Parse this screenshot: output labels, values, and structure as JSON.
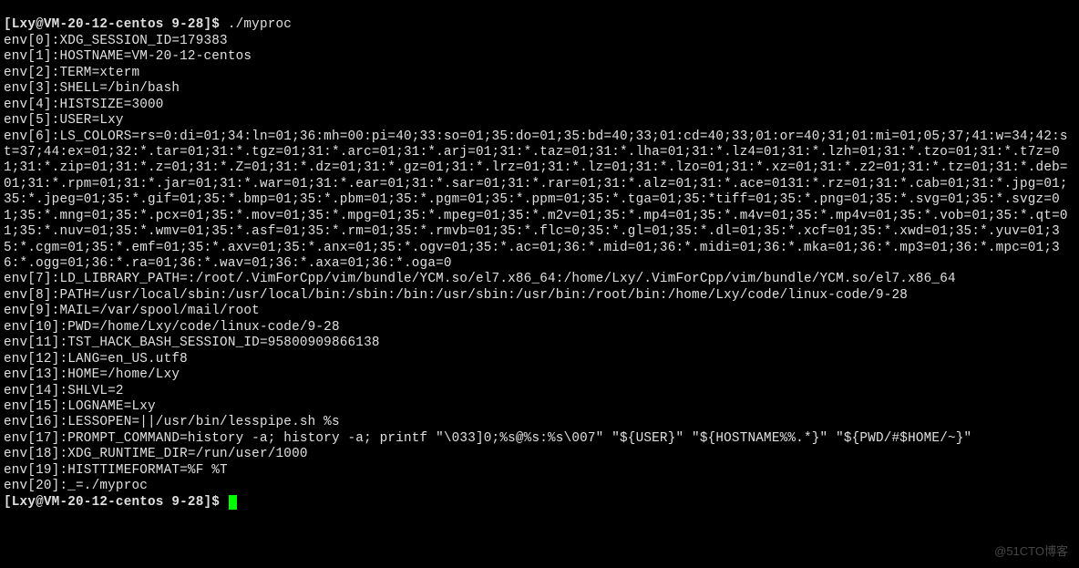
{
  "prompt1": {
    "user_host_path": "[Lxy@VM-20-12-centos 9-28]$",
    "command": "./myproc"
  },
  "env_lines": [
    "env[0]:XDG_SESSION_ID=179383",
    "env[1]:HOSTNAME=VM-20-12-centos",
    "env[2]:TERM=xterm",
    "env[3]:SHELL=/bin/bash",
    "env[4]:HISTSIZE=3000",
    "env[5]:USER=Lxy",
    "env[6]:LS_COLORS=rs=0:di=01;34:ln=01;36:mh=00:pi=40;33:so=01;35:do=01;35:bd=40;33;01:cd=40;33;01:or=40;31;01:mi=01;05;37;41:w=34;42:st=37;44:ex=01;32:*.tar=01;31:*.tgz=01;31:*.arc=01;31:*.arj=01;31:*.taz=01;31:*.lha=01;31:*.lz4=01;31:*.lzh=01;31:*.tzo=01;31:*.t7z=01;31:*.zip=01;31:*.z=01;31:*.Z=01;31:*.dz=01;31:*.gz=01;31:*.lrz=01;31:*.lz=01;31:*.lzo=01;31:*.xz=01;31:*.z2=01;31:*.tz=01;31:*.deb=01;31:*.rpm=01;31:*.jar=01;31:*.war=01;31:*.ear=01;31:*.sar=01;31:*.rar=01;31:*.alz=01;31:*.ace=0131:*.rz=01;31:*.cab=01;31:*.jpg=01;35:*.jpeg=01;35:*.gif=01;35:*.bmp=01;35:*.pbm=01;35:*.pgm=01;35:*.ppm=01;35:*.tga=01;35:*tiff=01;35:*.png=01;35:*.svg=01;35:*.svgz=01;35:*.mng=01;35:*.pcx=01;35:*.mov=01;35:*.mpg=01;35:*.mpeg=01;35:*.m2v=01;35:*.mp4=01;35:*.m4v=01;35:*.mp4v=01;35:*.vob=01;35:*.qt=01;35:*.nuv=01;35:*.wmv=01;35:*.asf=01;35:*.rm=01;35:*.rmvb=01;35:*.flc=0;35:*.gl=01;35:*.dl=01;35:*.xcf=01;35:*.xwd=01;35:*.yuv=01;35:*.cgm=01;35:*.emf=01;35:*.axv=01;35:*.anx=01;35:*.ogv=01;35:*.ac=01;36:*.mid=01;36:*.midi=01;36:*.mka=01;36:*.mp3=01;36:*.mpc=01;36:*.ogg=01;36:*.ra=01;36:*.wav=01;36:*.axa=01;36:*.oga=0",
    "env[7]:LD_LIBRARY_PATH=:/root/.VimForCpp/vim/bundle/YCM.so/el7.x86_64:/home/Lxy/.VimForCpp/vim/bundle/YCM.so/el7.x86_64",
    "env[8]:PATH=/usr/local/sbin:/usr/local/bin:/sbin:/bin:/usr/sbin:/usr/bin:/root/bin:/home/Lxy/code/linux-code/9-28",
    "env[9]:MAIL=/var/spool/mail/root",
    "env[10]:PWD=/home/Lxy/code/linux-code/9-28",
    "env[11]:TST_HACK_BASH_SESSION_ID=95800909866138",
    "env[12]:LANG=en_US.utf8",
    "env[13]:HOME=/home/Lxy",
    "env[14]:SHLVL=2",
    "env[15]:LOGNAME=Lxy",
    "env[16]:LESSOPEN=||/usr/bin/lesspipe.sh %s",
    "env[17]:PROMPT_COMMAND=history -a; history -a; printf \"\\033]0;%s@%s:%s\\007\" \"${USER}\" \"${HOSTNAME%%.*}\" \"${PWD/#$HOME/~}\"",
    "env[18]:XDG_RUNTIME_DIR=/run/user/1000",
    "env[19]:HISTTIMEFORMAT=%F %T",
    "env[20]:_=./myproc"
  ],
  "prompt2": {
    "user_host_path": "[Lxy@VM-20-12-centos 9-28]$"
  },
  "watermark": "@51CTO博客"
}
